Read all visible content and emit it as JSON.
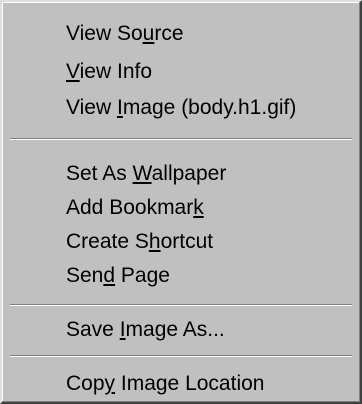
{
  "menu": {
    "groups": [
      {
        "items": [
          {
            "pre": "View So",
            "key": "u",
            "post": "rce"
          },
          {
            "pre": "",
            "key": "V",
            "post": "iew Info"
          },
          {
            "pre": "View ",
            "key": "I",
            "post": "mage (body.h1.gif)"
          }
        ]
      },
      {
        "items": [
          {
            "pre": "Set As ",
            "key": "W",
            "post": "allpaper"
          },
          {
            "pre": "Add Bookmar",
            "key": "k",
            "post": ""
          },
          {
            "pre": "Create S",
            "key": "h",
            "post": "ortcut"
          },
          {
            "pre": "Sen",
            "key": "d",
            "post": " Page"
          }
        ]
      },
      {
        "items": [
          {
            "pre": "Save ",
            "key": "I",
            "post": "mage As..."
          }
        ]
      },
      {
        "items": [
          {
            "pre": "Cop",
            "key": "y",
            "post": " Image Location"
          }
        ]
      }
    ]
  }
}
